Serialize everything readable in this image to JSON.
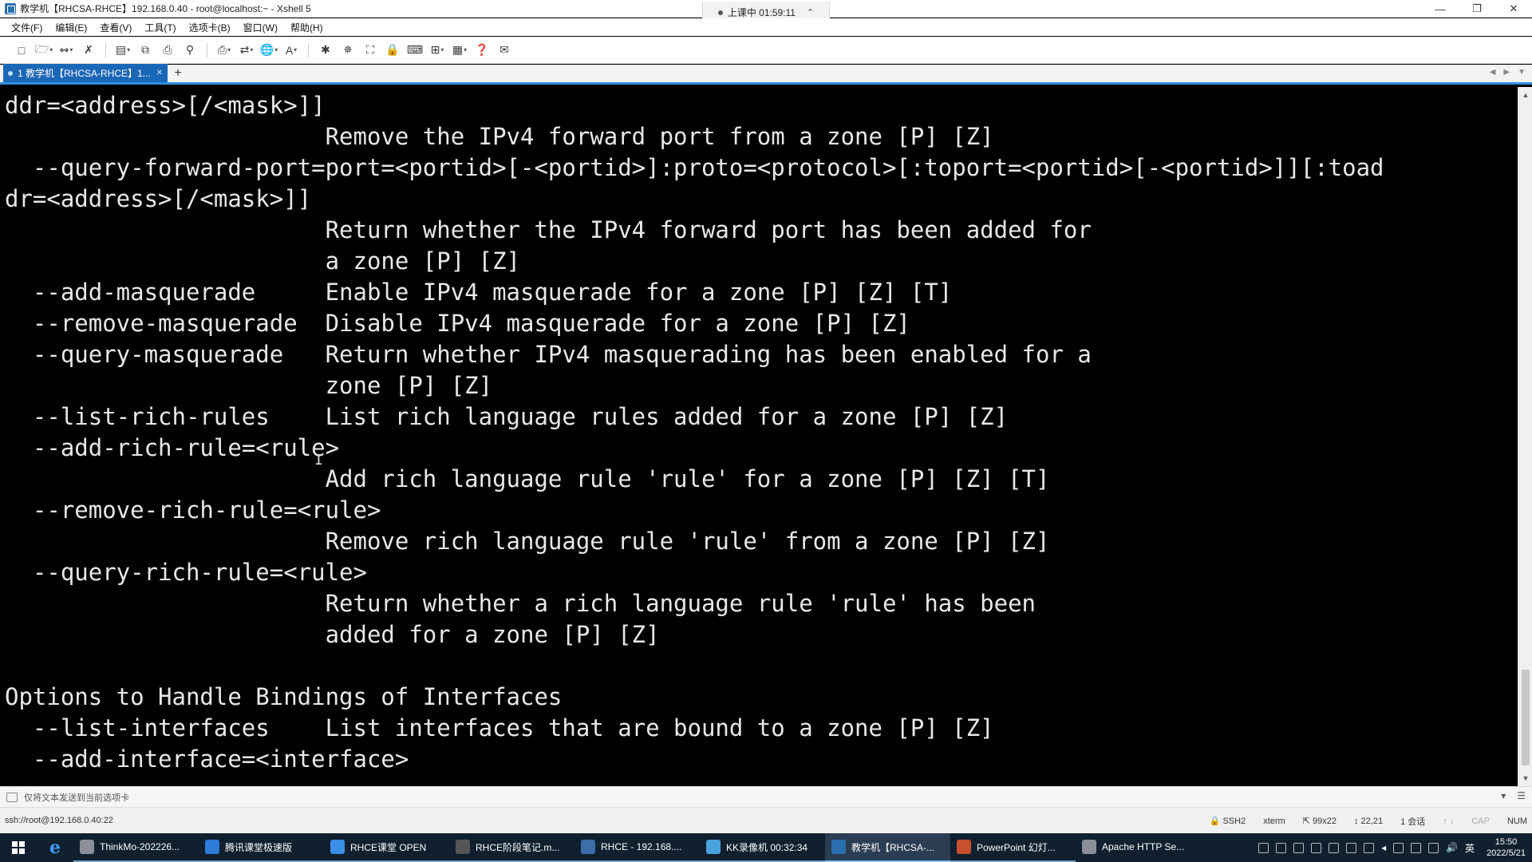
{
  "window": {
    "title": "教学机【RHCSA-RHCE】192.168.0.40 - root@localhost:~ - Xshell 5",
    "timer": "上课中 01:59:11"
  },
  "menu": [
    "文件(F)",
    "编辑(E)",
    "查看(V)",
    "工具(T)",
    "选项卡(B)",
    "窗口(W)",
    "帮助(H)"
  ],
  "tab": {
    "label": "1 教学机【RHCSA-RHCE】1..."
  },
  "terminal": {
    "lines": [
      "ddr=<address>[/<mask>]]",
      "                       Remove the IPv4 forward port from a zone [P] [Z]",
      "  --query-forward-port=port=<portid>[-<portid>]:proto=<protocol>[:toport=<portid>[-<portid>]][:toad",
      "dr=<address>[/<mask>]]",
      "                       Return whether the IPv4 forward port has been added for",
      "                       a zone [P] [Z]",
      "  --add-masquerade     Enable IPv4 masquerade for a zone [P] [Z] [T]",
      "  --remove-masquerade  Disable IPv4 masquerade for a zone [P] [Z]",
      "  --query-masquerade   Return whether IPv4 masquerading has been enabled for a",
      "                       zone [P] [Z]",
      "  --list-rich-rules    List rich language rules added for a zone [P] [Z]",
      "  --add-rich-rule=<rule>",
      "                       Add rich language rule 'rule' for a zone [P] [Z] [T]",
      "  --remove-rich-rule=<rule>",
      "                       Remove rich language rule 'rule' from a zone [P] [Z]",
      "  --query-rich-rule=<rule>",
      "                       Return whether a rich language rule 'rule' has been",
      "                       added for a zone [P] [Z]",
      "",
      "Options to Handle Bindings of Interfaces",
      "  --list-interfaces    List interfaces that are bound to a zone [P] [Z]",
      "  --add-interface=<interface>"
    ]
  },
  "compose": {
    "placeholder": "仅将文本发送到当前选项卡"
  },
  "status": {
    "connection": "ssh://root@192.168.0.40:22",
    "protocol": "SSH2",
    "terminal_type": "xterm",
    "size": "99x22",
    "cursor": "22,21",
    "sessions": "1 会话",
    "cap": "CAP",
    "num": "NUM"
  },
  "taskbar": {
    "items": [
      {
        "label": "ThinkMo-202226...",
        "color": "#8a8f99",
        "state": "running"
      },
      {
        "label": "腾讯课堂极速版",
        "color": "#2d7bd8",
        "state": "running"
      },
      {
        "label": "RHCE课堂 OPEN",
        "color": "#3a8ee6",
        "state": "running"
      },
      {
        "label": "RHCE阶段笔记.m...",
        "color": "#555555",
        "state": "running"
      },
      {
        "label": "RHCE - 192.168....",
        "color": "#3b6ea8",
        "state": "running"
      },
      {
        "label": "KK录像机 00:32:34",
        "color": "#4aa3df",
        "state": "running"
      },
      {
        "label": "教学机【RHCSA-...",
        "color": "#2a6fb0",
        "state": "active"
      },
      {
        "label": "PowerPoint 幻灯...",
        "color": "#c8502d",
        "state": "running"
      },
      {
        "label": "Apache HTTP Se...",
        "color": "#8a8f99",
        "state": "none"
      }
    ],
    "ime": "英",
    "time": "15:50",
    "date": "2022/5/21"
  },
  "colors": {
    "accent": "#1b67b7",
    "terminal_bg": "#000000",
    "terminal_fg": "#e8e8e8",
    "taskbar_bg": "#10202f"
  }
}
